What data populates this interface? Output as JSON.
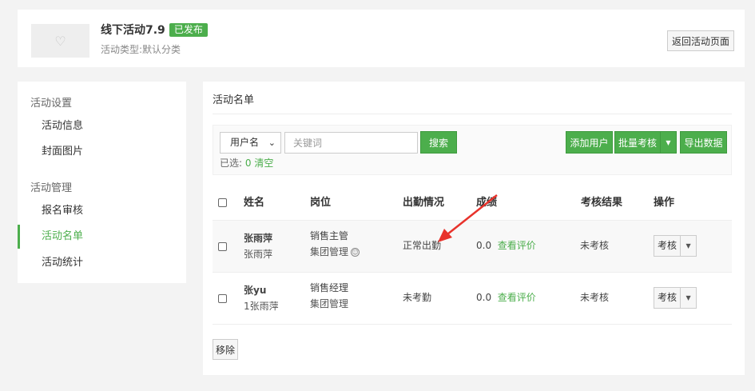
{
  "header": {
    "title": "线下活动7.9",
    "status": "已发布",
    "subtitle": "活动类型:默认分类",
    "back_button": "返回活动页面",
    "thumbnail_icon": "heart-icon"
  },
  "sidebar": {
    "groups": [
      {
        "label": "活动设置",
        "items": [
          "活动信息",
          "封面图片"
        ]
      },
      {
        "label": "活动管理",
        "items": [
          "报名审核",
          "活动名单",
          "活动统计"
        ]
      }
    ],
    "active_item": "活动名单"
  },
  "main": {
    "title": "活动名单",
    "search": {
      "field_select": "用户名",
      "keyword_placeholder": "关键词",
      "search_button": "搜索"
    },
    "actions": {
      "add_user": "添加用户",
      "bulk_review": "批量考核",
      "export": "导出数据"
    },
    "selection": {
      "label": "已选:",
      "count": "0",
      "clear": "清空"
    },
    "table": {
      "headers": [
        "姓名",
        "岗位",
        "出勤情况",
        "成绩",
        "考核结果",
        "操作"
      ],
      "rows": [
        {
          "name": "张雨萍",
          "sub_name": "张雨萍",
          "position": "销售主管",
          "department": "集团管理",
          "attendance": "正常出勤",
          "score": "0.0",
          "view_link": "查看评价",
          "result": "未考核",
          "action": "考核"
        },
        {
          "name": "张yu",
          "sub_name": "1张雨萍",
          "position": "销售经理",
          "department": "集团管理",
          "attendance": "未考勤",
          "score": "0.0",
          "view_link": "查看评价",
          "result": "未考核",
          "action": "考核"
        }
      ]
    },
    "remove_button": "移除"
  },
  "colors": {
    "accent": "#4cae4c",
    "annotation_arrow": "#e8322b"
  }
}
